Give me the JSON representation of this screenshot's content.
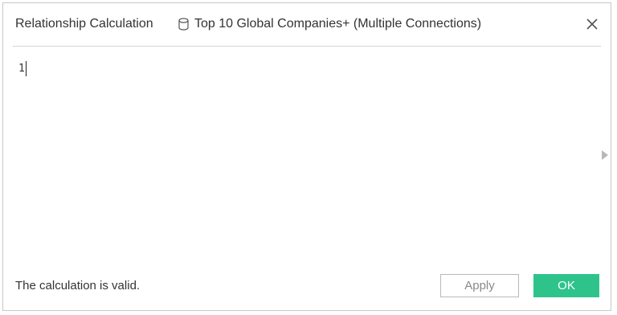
{
  "dialog": {
    "title": "Relationship Calculation",
    "datasource_icon": "database-icon",
    "datasource_name": "Top 10 Global Companies+ (Multiple Connections)",
    "close_icon": "close-icon"
  },
  "editor": {
    "content": "1",
    "expand_icon": "chevron-right-icon"
  },
  "footer": {
    "status": "The calculation is valid.",
    "apply_label": "Apply",
    "ok_label": "OK"
  },
  "colors": {
    "ok_button": "#2fc38c",
    "apply_text": "#8a8a8a",
    "divider": "#d4d4d4"
  }
}
